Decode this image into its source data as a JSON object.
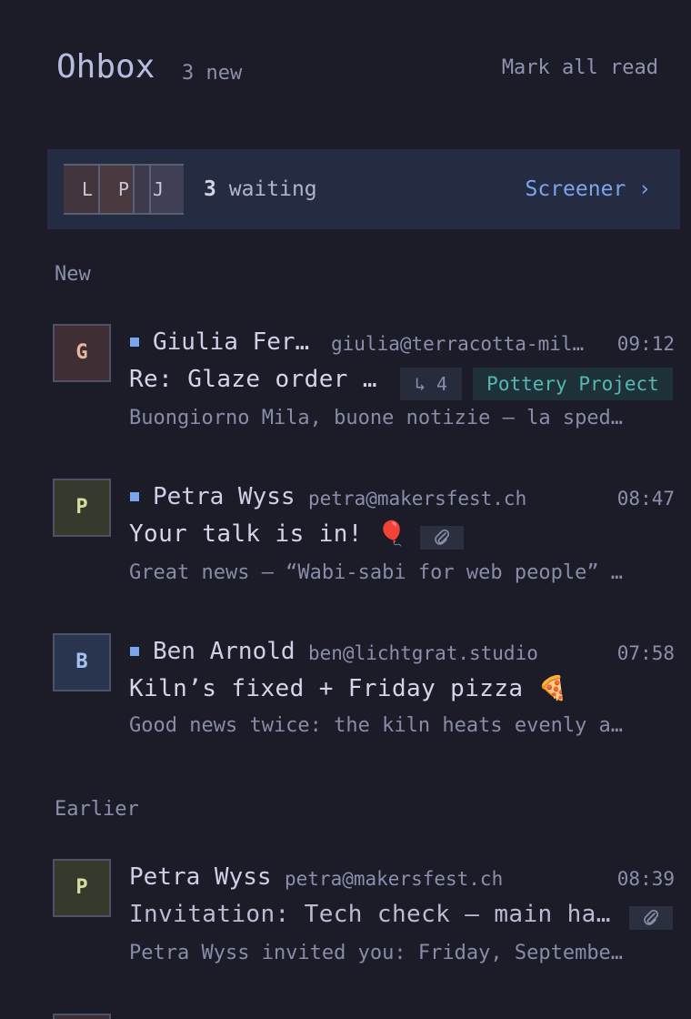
{
  "header": {
    "title": "Ohbox",
    "new_count": "3 new",
    "mark_all_read": "Mark all read"
  },
  "screener": {
    "avatars": [
      "L",
      "P",
      "J"
    ],
    "count": "3",
    "waiting_label": "waiting",
    "link": "Screener ›"
  },
  "sections": {
    "new": "New",
    "earlier": "Earlier"
  },
  "messages": [
    {
      "initial": "G",
      "sender": "Giulia Fer…",
      "email": "giulia@terracotta-mil…",
      "time": "09:12",
      "subject": "Re: Glaze order …",
      "thread_count": "↳ 4",
      "label": "Pottery Project",
      "preview": "Buongiorno Mila, buone notizie — la sped…",
      "unread": true,
      "avatar_bg": "#3f2e33",
      "avatar_fg": "#e6b7a3"
    },
    {
      "initial": "P",
      "sender": "Petra Wyss",
      "email": "petra@makersfest.ch",
      "time": "08:47",
      "subject": "Your talk is in! 🎈",
      "attachment_icon": "paperclip-icon",
      "preview": "Great news — “Wabi-sabi for web people” …",
      "unread": true,
      "avatar_bg": "#353a2c",
      "avatar_fg": "#d8dca0"
    },
    {
      "initial": "B",
      "sender": "Ben Arnold",
      "email": "ben@lichtgrat.studio",
      "time": "07:58",
      "subject": "Kiln’s fixed + Friday pizza 🍕",
      "preview": "Good news twice: the kiln heats evenly a…",
      "unread": true,
      "avatar_bg": "#2a3550",
      "avatar_fg": "#a8c2f0"
    },
    {
      "initial": "P",
      "sender": "Petra Wyss",
      "email": "petra@makersfest.ch",
      "time": "08:39",
      "subject": "Invitation: Tech check — main ha…",
      "attachment_icon": "paperclip-icon",
      "preview": "Petra Wyss invited you: Friday, Septembe…",
      "unread": false,
      "avatar_bg": "#353a2c",
      "avatar_fg": "#d8dca0"
    }
  ],
  "colors": {
    "background": "#1b1c28",
    "accent": "#7aa6f0",
    "label_teal": "#56b8b5"
  }
}
